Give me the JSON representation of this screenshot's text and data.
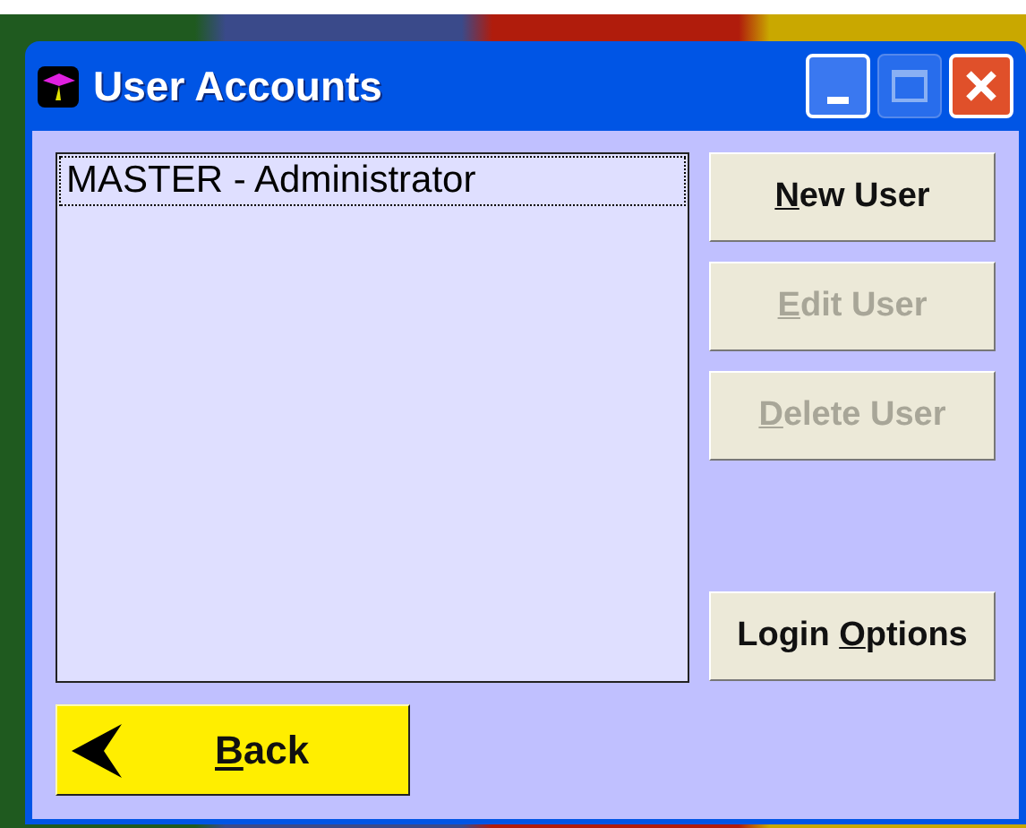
{
  "window": {
    "title": "User Accounts"
  },
  "users": [
    {
      "label": "MASTER - Administrator",
      "selected": true
    }
  ],
  "buttons": [
    {
      "key": "N",
      "after": "ew User",
      "disabled": false
    },
    {
      "key": "E",
      "after": "dit User",
      "disabled": true
    },
    {
      "key": "D",
      "after": "elete User",
      "disabled": true
    },
    {
      "before": "Login ",
      "key": "O",
      "after": "ptions",
      "disabled": false
    }
  ],
  "back_button": {
    "key": "B",
    "after": "ack"
  }
}
